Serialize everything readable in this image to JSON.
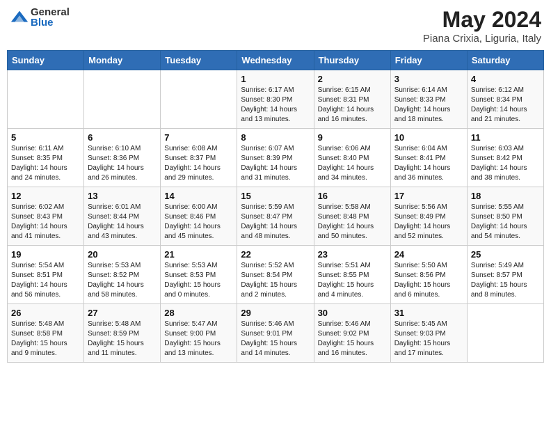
{
  "header": {
    "logo_general": "General",
    "logo_blue": "Blue",
    "month_title": "May 2024",
    "subtitle": "Piana Crixia, Liguria, Italy"
  },
  "weekdays": [
    "Sunday",
    "Monday",
    "Tuesday",
    "Wednesday",
    "Thursday",
    "Friday",
    "Saturday"
  ],
  "weeks": [
    [
      {
        "day": "",
        "sunrise": "",
        "sunset": "",
        "daylight": ""
      },
      {
        "day": "",
        "sunrise": "",
        "sunset": "",
        "daylight": ""
      },
      {
        "day": "",
        "sunrise": "",
        "sunset": "",
        "daylight": ""
      },
      {
        "day": "1",
        "sunrise": "Sunrise: 6:17 AM",
        "sunset": "Sunset: 8:30 PM",
        "daylight": "Daylight: 14 hours and 13 minutes."
      },
      {
        "day": "2",
        "sunrise": "Sunrise: 6:15 AM",
        "sunset": "Sunset: 8:31 PM",
        "daylight": "Daylight: 14 hours and 16 minutes."
      },
      {
        "day": "3",
        "sunrise": "Sunrise: 6:14 AM",
        "sunset": "Sunset: 8:33 PM",
        "daylight": "Daylight: 14 hours and 18 minutes."
      },
      {
        "day": "4",
        "sunrise": "Sunrise: 6:12 AM",
        "sunset": "Sunset: 8:34 PM",
        "daylight": "Daylight: 14 hours and 21 minutes."
      }
    ],
    [
      {
        "day": "5",
        "sunrise": "Sunrise: 6:11 AM",
        "sunset": "Sunset: 8:35 PM",
        "daylight": "Daylight: 14 hours and 24 minutes."
      },
      {
        "day": "6",
        "sunrise": "Sunrise: 6:10 AM",
        "sunset": "Sunset: 8:36 PM",
        "daylight": "Daylight: 14 hours and 26 minutes."
      },
      {
        "day": "7",
        "sunrise": "Sunrise: 6:08 AM",
        "sunset": "Sunset: 8:37 PM",
        "daylight": "Daylight: 14 hours and 29 minutes."
      },
      {
        "day": "8",
        "sunrise": "Sunrise: 6:07 AM",
        "sunset": "Sunset: 8:39 PM",
        "daylight": "Daylight: 14 hours and 31 minutes."
      },
      {
        "day": "9",
        "sunrise": "Sunrise: 6:06 AM",
        "sunset": "Sunset: 8:40 PM",
        "daylight": "Daylight: 14 hours and 34 minutes."
      },
      {
        "day": "10",
        "sunrise": "Sunrise: 6:04 AM",
        "sunset": "Sunset: 8:41 PM",
        "daylight": "Daylight: 14 hours and 36 minutes."
      },
      {
        "day": "11",
        "sunrise": "Sunrise: 6:03 AM",
        "sunset": "Sunset: 8:42 PM",
        "daylight": "Daylight: 14 hours and 38 minutes."
      }
    ],
    [
      {
        "day": "12",
        "sunrise": "Sunrise: 6:02 AM",
        "sunset": "Sunset: 8:43 PM",
        "daylight": "Daylight: 14 hours and 41 minutes."
      },
      {
        "day": "13",
        "sunrise": "Sunrise: 6:01 AM",
        "sunset": "Sunset: 8:44 PM",
        "daylight": "Daylight: 14 hours and 43 minutes."
      },
      {
        "day": "14",
        "sunrise": "Sunrise: 6:00 AM",
        "sunset": "Sunset: 8:46 PM",
        "daylight": "Daylight: 14 hours and 45 minutes."
      },
      {
        "day": "15",
        "sunrise": "Sunrise: 5:59 AM",
        "sunset": "Sunset: 8:47 PM",
        "daylight": "Daylight: 14 hours and 48 minutes."
      },
      {
        "day": "16",
        "sunrise": "Sunrise: 5:58 AM",
        "sunset": "Sunset: 8:48 PM",
        "daylight": "Daylight: 14 hours and 50 minutes."
      },
      {
        "day": "17",
        "sunrise": "Sunrise: 5:56 AM",
        "sunset": "Sunset: 8:49 PM",
        "daylight": "Daylight: 14 hours and 52 minutes."
      },
      {
        "day": "18",
        "sunrise": "Sunrise: 5:55 AM",
        "sunset": "Sunset: 8:50 PM",
        "daylight": "Daylight: 14 hours and 54 minutes."
      }
    ],
    [
      {
        "day": "19",
        "sunrise": "Sunrise: 5:54 AM",
        "sunset": "Sunset: 8:51 PM",
        "daylight": "Daylight: 14 hours and 56 minutes."
      },
      {
        "day": "20",
        "sunrise": "Sunrise: 5:53 AM",
        "sunset": "Sunset: 8:52 PM",
        "daylight": "Daylight: 14 hours and 58 minutes."
      },
      {
        "day": "21",
        "sunrise": "Sunrise: 5:53 AM",
        "sunset": "Sunset: 8:53 PM",
        "daylight": "Daylight: 15 hours and 0 minutes."
      },
      {
        "day": "22",
        "sunrise": "Sunrise: 5:52 AM",
        "sunset": "Sunset: 8:54 PM",
        "daylight": "Daylight: 15 hours and 2 minutes."
      },
      {
        "day": "23",
        "sunrise": "Sunrise: 5:51 AM",
        "sunset": "Sunset: 8:55 PM",
        "daylight": "Daylight: 15 hours and 4 minutes."
      },
      {
        "day": "24",
        "sunrise": "Sunrise: 5:50 AM",
        "sunset": "Sunset: 8:56 PM",
        "daylight": "Daylight: 15 hours and 6 minutes."
      },
      {
        "day": "25",
        "sunrise": "Sunrise: 5:49 AM",
        "sunset": "Sunset: 8:57 PM",
        "daylight": "Daylight: 15 hours and 8 minutes."
      }
    ],
    [
      {
        "day": "26",
        "sunrise": "Sunrise: 5:48 AM",
        "sunset": "Sunset: 8:58 PM",
        "daylight": "Daylight: 15 hours and 9 minutes."
      },
      {
        "day": "27",
        "sunrise": "Sunrise: 5:48 AM",
        "sunset": "Sunset: 8:59 PM",
        "daylight": "Daylight: 15 hours and 11 minutes."
      },
      {
        "day": "28",
        "sunrise": "Sunrise: 5:47 AM",
        "sunset": "Sunset: 9:00 PM",
        "daylight": "Daylight: 15 hours and 13 minutes."
      },
      {
        "day": "29",
        "sunrise": "Sunrise: 5:46 AM",
        "sunset": "Sunset: 9:01 PM",
        "daylight": "Daylight: 15 hours and 14 minutes."
      },
      {
        "day": "30",
        "sunrise": "Sunrise: 5:46 AM",
        "sunset": "Sunset: 9:02 PM",
        "daylight": "Daylight: 15 hours and 16 minutes."
      },
      {
        "day": "31",
        "sunrise": "Sunrise: 5:45 AM",
        "sunset": "Sunset: 9:03 PM",
        "daylight": "Daylight: 15 hours and 17 minutes."
      },
      {
        "day": "",
        "sunrise": "",
        "sunset": "",
        "daylight": ""
      }
    ]
  ]
}
